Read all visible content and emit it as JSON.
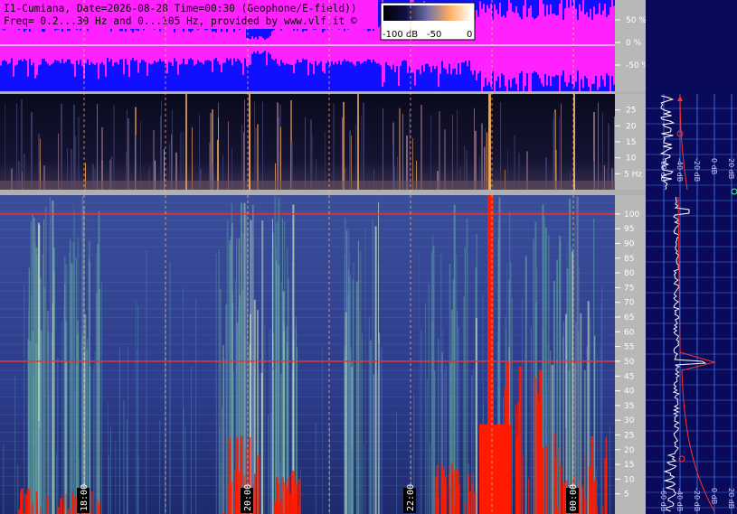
{
  "header": {
    "line1": "I1-Cumiana, Date=2026-08-28 Time=00:30 (Geophone/E-field))",
    "line2": "Freq= 0.2...30 Hz and 0...105 Hz, provided by www.vlf.it ©"
  },
  "colorbar": {
    "ticks": [
      "-100 dB",
      "-50",
      "0"
    ]
  },
  "chart_data": [
    {
      "type": "area",
      "name": "waveform",
      "yticks": [
        "50 %",
        "0 %",
        "-50 %"
      ],
      "ylim": [
        -100,
        100
      ],
      "colors": {
        "background": "#1010ff",
        "signal": "#ff22ff",
        "zero_line": "#ffffff"
      }
    },
    {
      "type": "heatmap",
      "name": "spectrogram-low",
      "ylim": [
        0,
        30
      ],
      "yticks": [
        25,
        20,
        15,
        10
      ],
      "last_tick_label": "5 Hz",
      "colors": {
        "low": "#0c0c24",
        "mid": "#6e6ea0",
        "high": "#ffb050"
      }
    },
    {
      "type": "heatmap",
      "name": "spectrogram-high",
      "ylim": [
        0,
        105
      ],
      "yticks": [
        100,
        95,
        90,
        85,
        80,
        75,
        70,
        65,
        60,
        55,
        50,
        45,
        40,
        35,
        30,
        25,
        20,
        15,
        10,
        5
      ],
      "hum_lines_hz": [
        50,
        100
      ],
      "time_labels": [
        "18:00",
        "20:00",
        "22:00",
        "00:00"
      ],
      "colors": {
        "low": "#2a3a8c",
        "mid": "#5fa6a0",
        "high": "#ffffff",
        "saturated": "#ff1a00"
      }
    },
    {
      "type": "line",
      "name": "spectrum-profile",
      "xticks": [
        "-60 dB",
        "-40 dB",
        "-20 dB",
        "0 dB",
        "20 dB"
      ],
      "colors": {
        "background": "#0a0a5a",
        "trace": "#ffffff",
        "fit": "#ff3030",
        "grid": "#3a6ad0"
      }
    }
  ]
}
